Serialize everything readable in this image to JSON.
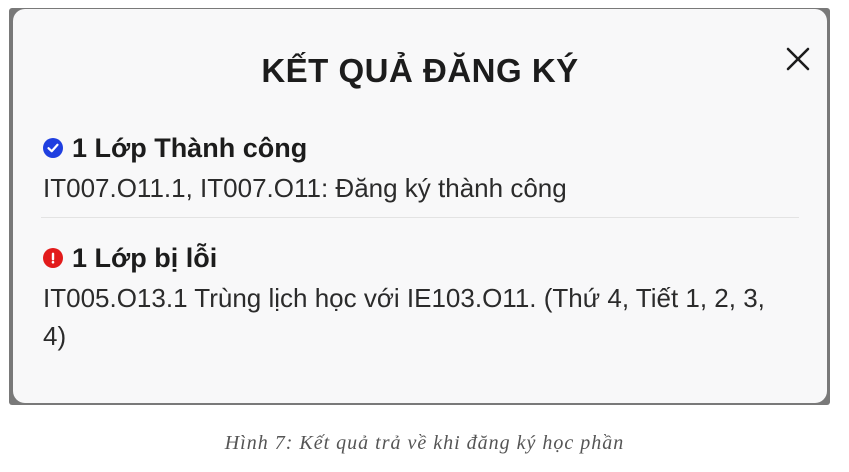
{
  "dialog": {
    "title": "KẾT QUẢ ĐĂNG KÝ",
    "close_icon": "close-icon",
    "success": {
      "icon": "check-circle-icon",
      "icon_color": "#1f3fe0",
      "title": "1 Lớp Thành công",
      "detail": "IT007.O11.1, IT007.O11: Đăng ký thành công"
    },
    "error": {
      "icon": "exclamation-circle-icon",
      "icon_color": "#e21b1b",
      "title": "1 Lớp bị lỗi",
      "detail": "IT005.O13.1 Trùng lịch học với IE103.O11. (Thứ 4, Tiết 1, 2, 3, 4)"
    }
  },
  "caption": "Hình 7: Kết quả trả về khi đăng ký học phần"
}
